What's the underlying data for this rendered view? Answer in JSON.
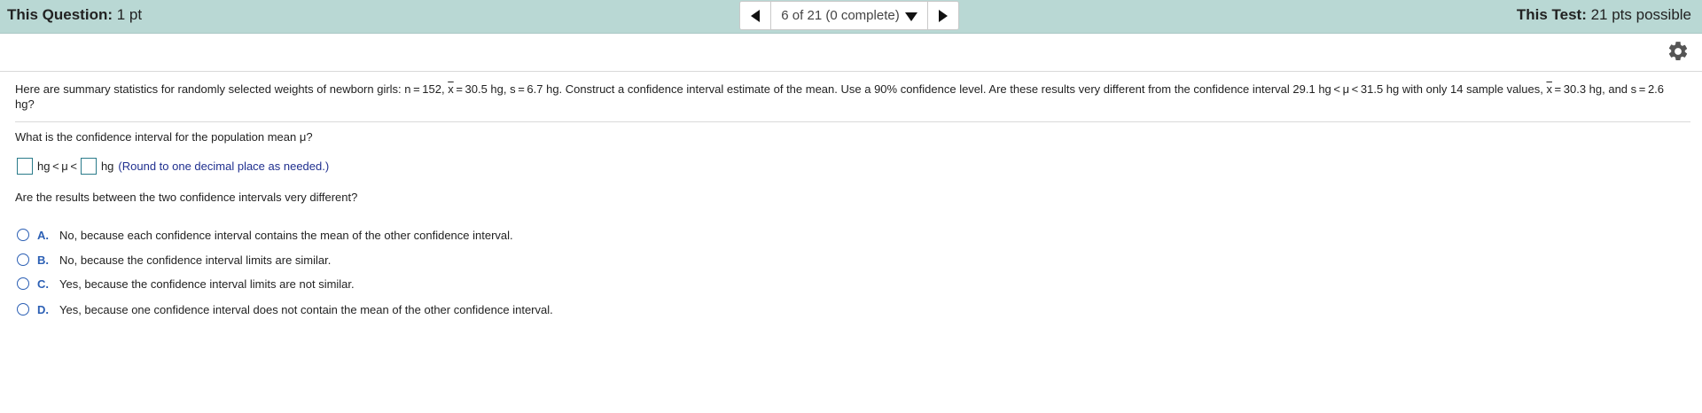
{
  "header": {
    "question_label": "This Question:",
    "question_value": "1 pt",
    "test_label": "This Test:",
    "test_value": "21 pts possible",
    "nav_select_label": "6 of 21 (0 complete)",
    "prev_icon": "left-triangle",
    "next_icon": "right-triangle",
    "dropdown_icon": "down-triangle"
  },
  "toolbar": {
    "settings_icon": "gear-icon"
  },
  "problem": {
    "part1": "Here are summary statistics for randomly selected weights of newborn girls: n = 152, ",
    "xbar_symbol": "x",
    "part2": " = 30.5 hg, s = 6.7 hg. Construct a confidence interval estimate of the mean. Use a 90% confidence level. Are these results very different from the confidence interval 29.1 hg < μ < 31.5 hg with only 14 sample values, ",
    "part3": " = 30.3 hg, and s = 2.6 hg?"
  },
  "question1": {
    "prompt": "What is the confidence interval for the population mean μ?",
    "middle_text": "hg < μ <",
    "end_text": "hg",
    "hint": "(Round to one decimal place as needed.)",
    "lower_value": "",
    "upper_value": ""
  },
  "question2": {
    "prompt": "Are the results between the two confidence intervals very different?",
    "options": [
      {
        "letter": "A.",
        "text": "No, because each confidence interval contains the mean of the other confidence interval."
      },
      {
        "letter": "B.",
        "text": "No, because the confidence interval limits are similar."
      },
      {
        "letter": "C.",
        "text": "Yes, because the confidence interval limits are not similar."
      },
      {
        "letter": "D.",
        "text": "Yes, because one confidence interval does not contain the mean of the other confidence interval."
      }
    ]
  },
  "colors": {
    "header_bg": "#b9d8d4",
    "accent_blue": "#2b5fb4",
    "hint_blue": "#1f2f8f",
    "input_border": "#2a7b8a"
  }
}
